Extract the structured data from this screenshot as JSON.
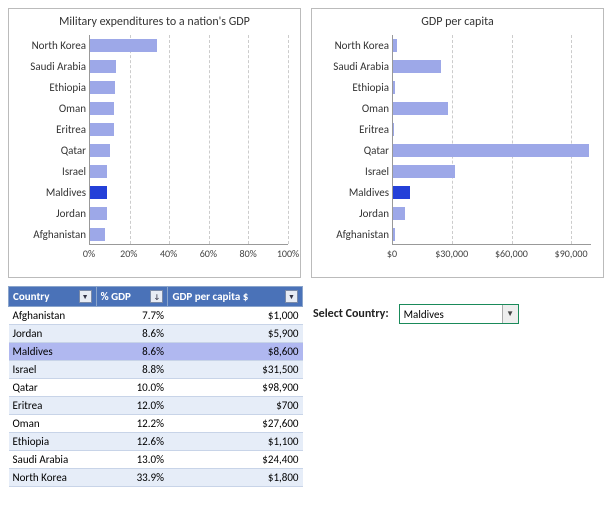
{
  "highlight_country": "Maldives",
  "chart_data": [
    {
      "type": "bar",
      "orientation": "horizontal",
      "title": "Military expenditures to a nation's GDP",
      "categories": [
        "North Korea",
        "Saudi Arabia",
        "Ethiopia",
        "Oman",
        "Eritrea",
        "Qatar",
        "Israel",
        "Maldives",
        "Jordan",
        "Afghanistan"
      ],
      "values": [
        33.9,
        13.0,
        12.6,
        12.2,
        12.0,
        10.0,
        8.8,
        8.6,
        8.6,
        7.7
      ],
      "xlabel": "",
      "ylabel": "",
      "xlim": [
        0,
        100
      ],
      "x_ticks": [
        "0%",
        "20%",
        "40%",
        "60%",
        "80%",
        "100%"
      ],
      "value_format": "percent"
    },
    {
      "type": "bar",
      "orientation": "horizontal",
      "title": "GDP per capita",
      "categories": [
        "North Korea",
        "Saudi Arabia",
        "Ethiopia",
        "Oman",
        "Eritrea",
        "Qatar",
        "Israel",
        "Maldives",
        "Jordan",
        "Afghanistan"
      ],
      "values": [
        1800,
        24400,
        1100,
        27600,
        700,
        98900,
        31500,
        8600,
        5900,
        1000
      ],
      "xlabel": "",
      "ylabel": "",
      "xlim": [
        0,
        100000
      ],
      "x_ticks": [
        "$0",
        "$30,000",
        "$60,000",
        "$90,000"
      ],
      "value_format": "dollars"
    }
  ],
  "table": {
    "headers": [
      "Country",
      "% GDP",
      "GDP per capita $"
    ],
    "rows": [
      {
        "country": "Afghanistan",
        "pct": "7.7%",
        "gdp": "$1,000"
      },
      {
        "country": "Jordan",
        "pct": "8.6%",
        "gdp": "$5,900"
      },
      {
        "country": "Maldives",
        "pct": "8.6%",
        "gdp": "$8,600"
      },
      {
        "country": "Israel",
        "pct": "8.8%",
        "gdp": "$31,500"
      },
      {
        "country": "Qatar",
        "pct": "10.0%",
        "gdp": "$98,900"
      },
      {
        "country": "Eritrea",
        "pct": "12.0%",
        "gdp": "$700"
      },
      {
        "country": "Oman",
        "pct": "12.2%",
        "gdp": "$27,600"
      },
      {
        "country": "Ethiopia",
        "pct": "12.6%",
        "gdp": "$1,100"
      },
      {
        "country": "Saudi Arabia",
        "pct": "13.0%",
        "gdp": "$24,400"
      },
      {
        "country": "North Korea",
        "pct": "33.9%",
        "gdp": "$1,800"
      }
    ]
  },
  "selector": {
    "label": "Select Country:",
    "value": "Maldives"
  }
}
